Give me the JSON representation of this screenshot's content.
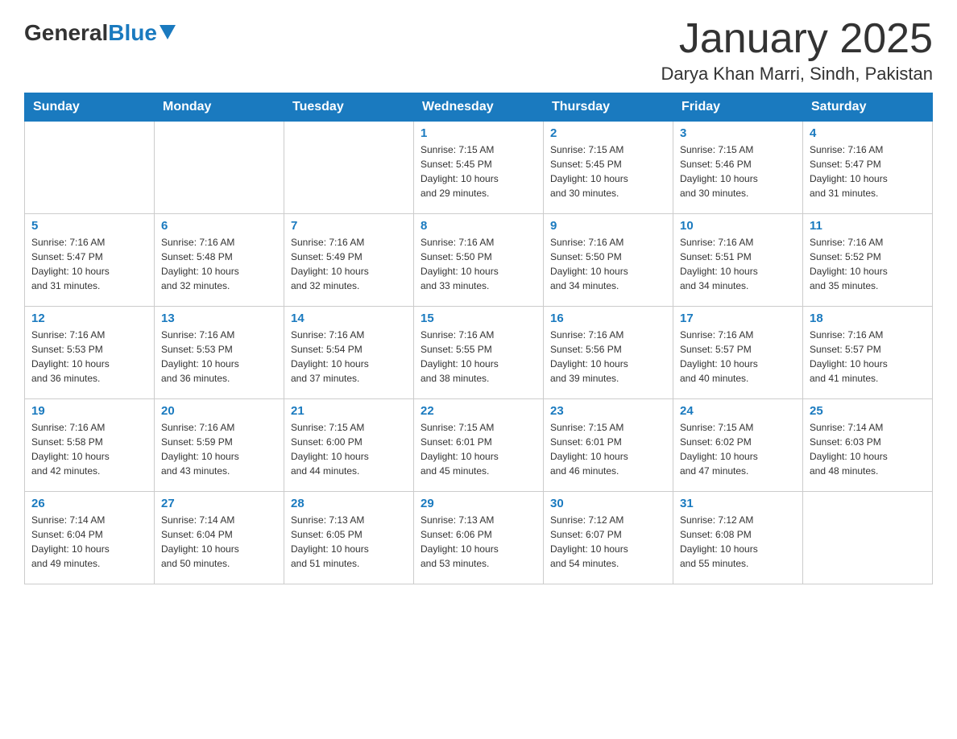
{
  "header": {
    "logo_general": "General",
    "logo_blue": "Blue",
    "month_title": "January 2025",
    "location": "Darya Khan Marri, Sindh, Pakistan"
  },
  "weekdays": [
    "Sunday",
    "Monday",
    "Tuesday",
    "Wednesday",
    "Thursday",
    "Friday",
    "Saturday"
  ],
  "weeks": [
    [
      {
        "day": "",
        "info": ""
      },
      {
        "day": "",
        "info": ""
      },
      {
        "day": "",
        "info": ""
      },
      {
        "day": "1",
        "info": "Sunrise: 7:15 AM\nSunset: 5:45 PM\nDaylight: 10 hours\nand 29 minutes."
      },
      {
        "day": "2",
        "info": "Sunrise: 7:15 AM\nSunset: 5:45 PM\nDaylight: 10 hours\nand 30 minutes."
      },
      {
        "day": "3",
        "info": "Sunrise: 7:15 AM\nSunset: 5:46 PM\nDaylight: 10 hours\nand 30 minutes."
      },
      {
        "day": "4",
        "info": "Sunrise: 7:16 AM\nSunset: 5:47 PM\nDaylight: 10 hours\nand 31 minutes."
      }
    ],
    [
      {
        "day": "5",
        "info": "Sunrise: 7:16 AM\nSunset: 5:47 PM\nDaylight: 10 hours\nand 31 minutes."
      },
      {
        "day": "6",
        "info": "Sunrise: 7:16 AM\nSunset: 5:48 PM\nDaylight: 10 hours\nand 32 minutes."
      },
      {
        "day": "7",
        "info": "Sunrise: 7:16 AM\nSunset: 5:49 PM\nDaylight: 10 hours\nand 32 minutes."
      },
      {
        "day": "8",
        "info": "Sunrise: 7:16 AM\nSunset: 5:50 PM\nDaylight: 10 hours\nand 33 minutes."
      },
      {
        "day": "9",
        "info": "Sunrise: 7:16 AM\nSunset: 5:50 PM\nDaylight: 10 hours\nand 34 minutes."
      },
      {
        "day": "10",
        "info": "Sunrise: 7:16 AM\nSunset: 5:51 PM\nDaylight: 10 hours\nand 34 minutes."
      },
      {
        "day": "11",
        "info": "Sunrise: 7:16 AM\nSunset: 5:52 PM\nDaylight: 10 hours\nand 35 minutes."
      }
    ],
    [
      {
        "day": "12",
        "info": "Sunrise: 7:16 AM\nSunset: 5:53 PM\nDaylight: 10 hours\nand 36 minutes."
      },
      {
        "day": "13",
        "info": "Sunrise: 7:16 AM\nSunset: 5:53 PM\nDaylight: 10 hours\nand 36 minutes."
      },
      {
        "day": "14",
        "info": "Sunrise: 7:16 AM\nSunset: 5:54 PM\nDaylight: 10 hours\nand 37 minutes."
      },
      {
        "day": "15",
        "info": "Sunrise: 7:16 AM\nSunset: 5:55 PM\nDaylight: 10 hours\nand 38 minutes."
      },
      {
        "day": "16",
        "info": "Sunrise: 7:16 AM\nSunset: 5:56 PM\nDaylight: 10 hours\nand 39 minutes."
      },
      {
        "day": "17",
        "info": "Sunrise: 7:16 AM\nSunset: 5:57 PM\nDaylight: 10 hours\nand 40 minutes."
      },
      {
        "day": "18",
        "info": "Sunrise: 7:16 AM\nSunset: 5:57 PM\nDaylight: 10 hours\nand 41 minutes."
      }
    ],
    [
      {
        "day": "19",
        "info": "Sunrise: 7:16 AM\nSunset: 5:58 PM\nDaylight: 10 hours\nand 42 minutes."
      },
      {
        "day": "20",
        "info": "Sunrise: 7:16 AM\nSunset: 5:59 PM\nDaylight: 10 hours\nand 43 minutes."
      },
      {
        "day": "21",
        "info": "Sunrise: 7:15 AM\nSunset: 6:00 PM\nDaylight: 10 hours\nand 44 minutes."
      },
      {
        "day": "22",
        "info": "Sunrise: 7:15 AM\nSunset: 6:01 PM\nDaylight: 10 hours\nand 45 minutes."
      },
      {
        "day": "23",
        "info": "Sunrise: 7:15 AM\nSunset: 6:01 PM\nDaylight: 10 hours\nand 46 minutes."
      },
      {
        "day": "24",
        "info": "Sunrise: 7:15 AM\nSunset: 6:02 PM\nDaylight: 10 hours\nand 47 minutes."
      },
      {
        "day": "25",
        "info": "Sunrise: 7:14 AM\nSunset: 6:03 PM\nDaylight: 10 hours\nand 48 minutes."
      }
    ],
    [
      {
        "day": "26",
        "info": "Sunrise: 7:14 AM\nSunset: 6:04 PM\nDaylight: 10 hours\nand 49 minutes."
      },
      {
        "day": "27",
        "info": "Sunrise: 7:14 AM\nSunset: 6:04 PM\nDaylight: 10 hours\nand 50 minutes."
      },
      {
        "day": "28",
        "info": "Sunrise: 7:13 AM\nSunset: 6:05 PM\nDaylight: 10 hours\nand 51 minutes."
      },
      {
        "day": "29",
        "info": "Sunrise: 7:13 AM\nSunset: 6:06 PM\nDaylight: 10 hours\nand 53 minutes."
      },
      {
        "day": "30",
        "info": "Sunrise: 7:12 AM\nSunset: 6:07 PM\nDaylight: 10 hours\nand 54 minutes."
      },
      {
        "day": "31",
        "info": "Sunrise: 7:12 AM\nSunset: 6:08 PM\nDaylight: 10 hours\nand 55 minutes."
      },
      {
        "day": "",
        "info": ""
      }
    ]
  ]
}
